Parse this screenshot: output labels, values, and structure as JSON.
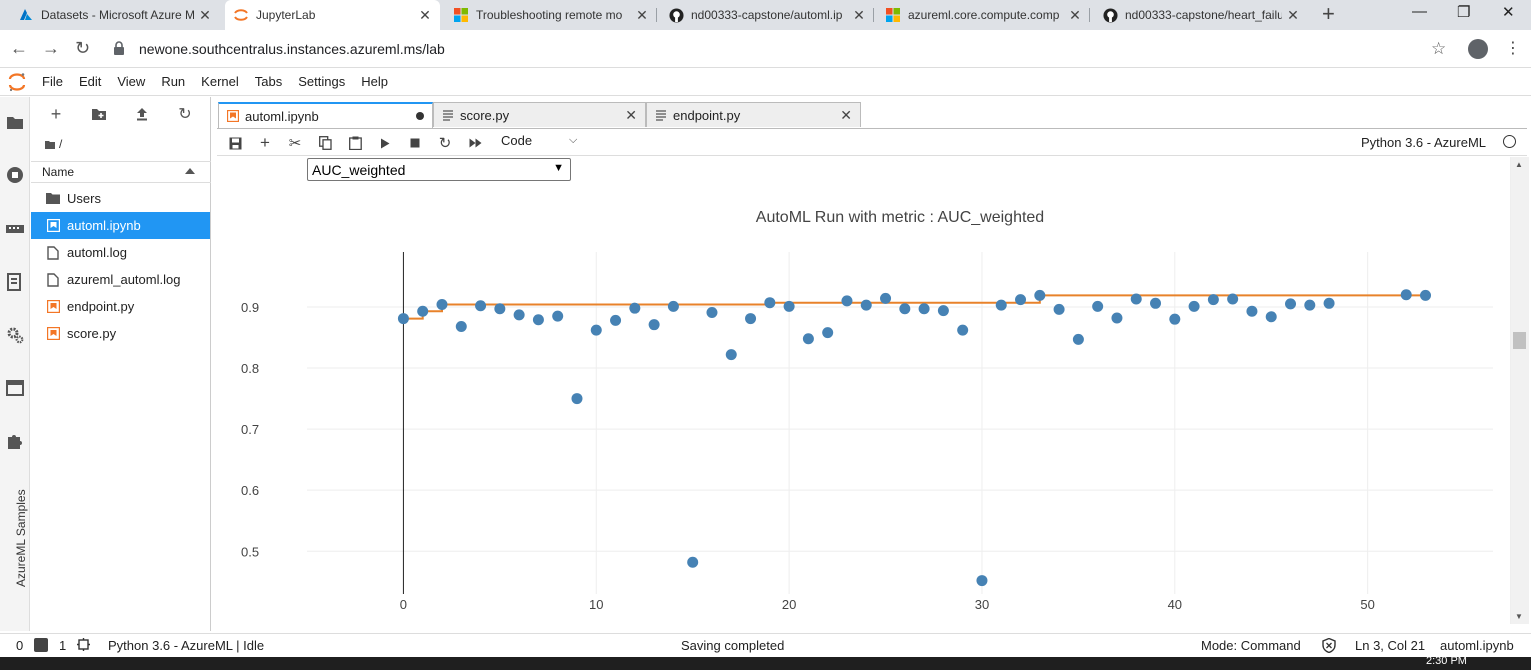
{
  "browser": {
    "tabs": [
      {
        "title": "Datasets - Microsoft Azure M",
        "icon": "azure-icon"
      },
      {
        "title": "JupyterLab",
        "icon": "jupyter-icon"
      },
      {
        "title": "Troubleshooting remote mo",
        "icon": "microsoft-icon"
      },
      {
        "title": "nd00333-capstone/automl.ip",
        "icon": "github-icon"
      },
      {
        "title": "azureml.core.compute.comp",
        "icon": "microsoft-icon"
      },
      {
        "title": "nd00333-capstone/heart_failu",
        "icon": "github-icon"
      }
    ],
    "url": "newone.southcentralus.instances.azureml.ms/lab"
  },
  "menubar": {
    "items": [
      "File",
      "Edit",
      "View",
      "Run",
      "Kernel",
      "Tabs",
      "Settings",
      "Help"
    ]
  },
  "sidebar": {
    "vertical_label": "AzureML Samples"
  },
  "filebrowser": {
    "breadcrumb": "/",
    "column_header": "Name",
    "items": [
      {
        "name": "Users",
        "type": "folder"
      },
      {
        "name": "automl.ipynb",
        "type": "notebook"
      },
      {
        "name": "automl.log",
        "type": "file"
      },
      {
        "name": "azureml_automl.log",
        "type": "file"
      },
      {
        "name": "endpoint.py",
        "type": "python"
      },
      {
        "name": "score.py",
        "type": "python"
      }
    ]
  },
  "doc_tabs": [
    {
      "title": "automl.ipynb"
    },
    {
      "title": "score.py"
    },
    {
      "title": "endpoint.py"
    }
  ],
  "toolbar": {
    "cell_type": "Code",
    "kernel": "Python 3.6 - AzureML"
  },
  "notebook": {
    "metric_dropdown": "AUC_weighted"
  },
  "chart_data": {
    "type": "scatter",
    "title": "AutoML Run with metric : AUC_weighted",
    "xlabel": "",
    "ylabel": "",
    "xlim": [
      -5,
      56.5
    ],
    "ylim": [
      0.43,
      0.99
    ],
    "x_ticks": [
      0,
      10,
      20,
      30,
      40,
      50
    ],
    "y_ticks": [
      0.5,
      0.6,
      0.7,
      0.8,
      0.9
    ],
    "grid": true,
    "colors": {
      "points": "#4682b4",
      "best_line": "#e8822a",
      "grid": "#eeeeee"
    },
    "series": [
      {
        "x": [
          0,
          1,
          2,
          3,
          4,
          5,
          6,
          7,
          8,
          9,
          10,
          11,
          12,
          13,
          14,
          15,
          16,
          17,
          18,
          19,
          20,
          21,
          22,
          23,
          24,
          25,
          26,
          27,
          28,
          29,
          30,
          31,
          32,
          33,
          34,
          35,
          36,
          37,
          38,
          39,
          40,
          41,
          42,
          43,
          44,
          45,
          46,
          47,
          48,
          52,
          53
        ],
        "values": [
          0.881,
          0.893,
          0.904,
          0.868,
          0.902,
          0.897,
          0.887,
          0.879,
          0.885,
          0.75,
          0.862,
          0.878,
          0.898,
          0.871,
          0.901,
          0.482,
          0.891,
          0.822,
          0.881,
          0.907,
          0.901,
          0.848,
          0.858,
          0.91,
          0.903,
          0.914,
          0.897,
          0.897,
          0.894,
          0.862,
          0.452,
          0.903,
          0.912,
          0.919,
          0.896,
          0.847,
          0.901,
          0.882,
          0.913,
          0.906,
          0.88,
          0.901,
          0.912,
          0.913,
          0.893,
          0.884,
          0.905,
          0.903,
          0.906,
          0.92,
          0.919
        ]
      },
      {
        "type": "step",
        "x": [
          0,
          1,
          2,
          19,
          33,
          53
        ],
        "values": [
          0.881,
          0.893,
          0.904,
          0.907,
          0.919,
          0.919
        ]
      }
    ]
  },
  "statusbar": {
    "terminals": "0",
    "kernels": "1",
    "kernel_status": "Python 3.6 - AzureML | Idle",
    "message": "Saving completed",
    "mode": "Mode: Command",
    "cursor": "Ln 3, Col 21",
    "file": "automl.ipynb"
  },
  "taskbar": {
    "clock": "2:30 PM"
  }
}
